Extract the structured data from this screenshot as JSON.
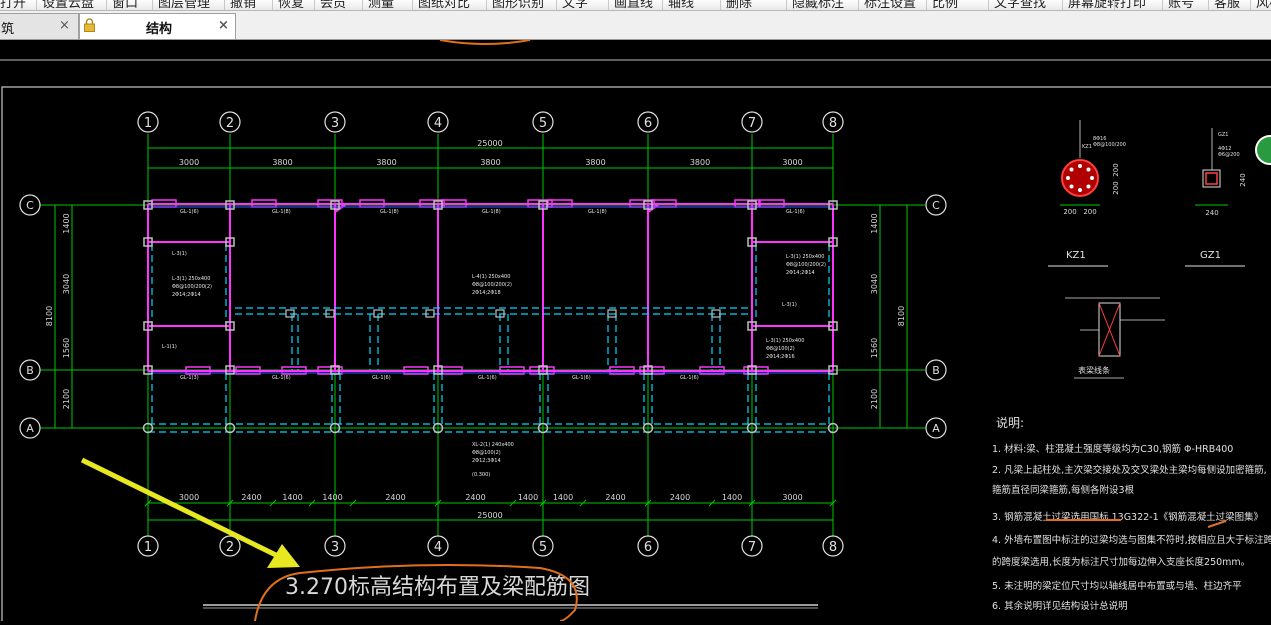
{
  "menubar": {
    "items": [
      "打开",
      "设置云盘",
      "窗口",
      "图层管理",
      "撤销",
      "恢复",
      "会员",
      "测量",
      "图纸对比",
      "图形识别",
      "文字",
      "画直线",
      "轴线",
      "删除",
      "隐藏标注",
      "标注设置",
      "比例",
      "文字查找",
      "屏幕旋转",
      "打印",
      "账号",
      "客服",
      "风格"
    ]
  },
  "tabs": [
    {
      "label": "筑",
      "close": "×"
    },
    {
      "label": "结构",
      "close": "×"
    }
  ],
  "drawing": {
    "axes_numbers": [
      "1",
      "2",
      "3",
      "4",
      "5",
      "6",
      "7",
      "8"
    ],
    "axes_letters": [
      "C",
      "B",
      "A"
    ],
    "top_total": "25000",
    "top_spans": [
      "3000",
      "3800",
      "3800",
      "3800",
      "3800",
      "3800",
      "3000"
    ],
    "bottom_total": "25000",
    "bottom_spans": [
      "3000",
      "2400",
      "1400",
      "1400",
      "2400",
      "2400",
      "1400",
      "1400",
      "2400",
      "2400",
      "1400",
      "3000"
    ],
    "left_dims": [
      "1400",
      "3040",
      "1560",
      "2100"
    ],
    "left_total": "8100",
    "right_dims": [
      "1400",
      "3040",
      "1560",
      "2100"
    ],
    "right_total": "8100",
    "plan_title": "3.270标高结构布置及梁配筋图",
    "kz1_label": "KZ1",
    "gz1_label": "GZ1",
    "kz1_dims": [
      "200",
      "200",
      "200",
      "200"
    ],
    "gz1_dims": [
      "240",
      "240"
    ],
    "detail_label": "表梁线条",
    "notes_title": "说明:",
    "notes": [
      "1. 材料:梁、柱混凝土强度等级均为C30,钢筋 Φ-HRB400",
      "2. 凡梁上起柱处,主次梁交接处及交叉梁处主梁均每侧设加密箍筋,",
      "   箍筋直径同梁箍筋,每侧各附设3根",
      "3. 钢筋混凝土过梁选用国标 13G322-1《钢筋混凝土过梁图集》",
      "4. 外墙布置图中标注的过梁均选与图集不符时,按相应且大于标注跨度",
      "   的跨度梁选用,长度为标注尺寸加每边伸入支座长度250mm。",
      "5. 未注明的梁定位尺寸均以轴线居中布置或与墙、柱边齐平",
      "6. 其余说明详见结构设计总说明"
    ]
  },
  "colors": {
    "grid_green": "#00c800",
    "beam_magenta": "#ff33ff",
    "dash_cyan": "#00d8ff",
    "column_gray": "#c0c0c0",
    "annotation_orange": "#e0701c",
    "arrow_yellow": "#e8e820"
  }
}
